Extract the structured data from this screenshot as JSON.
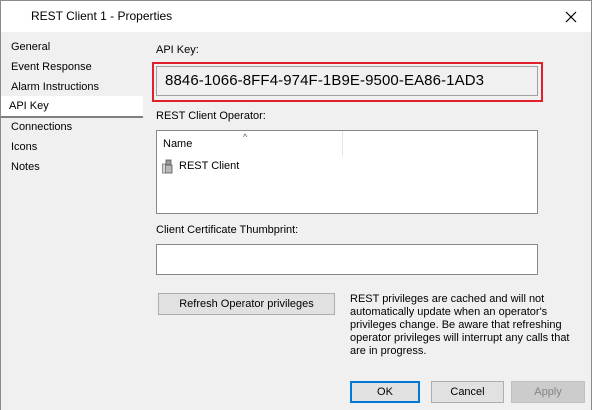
{
  "window": {
    "title": "REST Client 1 - Properties"
  },
  "sidebar": {
    "items": [
      {
        "label": "General"
      },
      {
        "label": "Event Response"
      },
      {
        "label": "Alarm Instructions"
      },
      {
        "label": "API Key"
      },
      {
        "label": "Connections"
      },
      {
        "label": "Icons"
      },
      {
        "label": "Notes"
      }
    ],
    "selected": "API Key"
  },
  "api_key": {
    "label": "API Key:",
    "value": "8846-1066-8FF4-974F-1B9E-9500-EA86-1AD3"
  },
  "operator": {
    "label": "REST Client Operator:",
    "column_name": "Name",
    "rows": [
      {
        "name": "REST Client",
        "icon": "user-icon"
      }
    ]
  },
  "thumbprint": {
    "label": "Client Certificate Thumbprint:",
    "value": ""
  },
  "refresh": {
    "button_label": "Refresh Operator privileges",
    "note": "REST privileges are cached and will not automatically update when an operator's privileges change. Be aware that refreshing operator privileges will interrupt any calls that are in progress."
  },
  "footer": {
    "ok_label": "OK",
    "cancel_label": "Cancel",
    "apply_label": "Apply"
  },
  "colors": {
    "highlight": "#e0202a",
    "default_button_border": "#0078d7"
  }
}
